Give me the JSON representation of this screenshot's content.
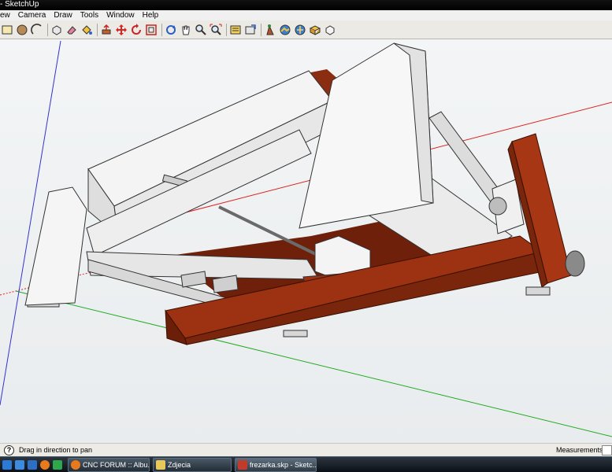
{
  "window": {
    "title": "- SketchUp"
  },
  "menus": [
    "ew",
    "Camera",
    "Draw",
    "Tools",
    "Window",
    "Help"
  ],
  "toolbar": {
    "tools": [
      "rectangle-icon",
      "circle-icon",
      "arc-icon",
      "separator",
      "make-component-icon",
      "eraser-icon",
      "paint-bucket-icon",
      "separator",
      "push-pull-icon",
      "move-icon",
      "rotate-icon",
      "offset-icon",
      "separator",
      "orbit-icon",
      "pan-icon",
      "zoom-icon",
      "zoom-extents-icon",
      "separator",
      "get-models-icon",
      "share-model-icon",
      "separator",
      "google-earth-icon",
      "toggle-terrain-icon",
      "place-model-icon",
      "get-current-view-icon",
      "get-photo-texture-icon"
    ]
  },
  "status": {
    "message": "Drag in direction to pan",
    "measurements_label": "Measurements",
    "measurements_value": ""
  },
  "taskbar": {
    "items": [
      {
        "label": "CNC FORUM :: Albu...",
        "icon": "firefox-icon",
        "active": false
      },
      {
        "label": "Zdjecia",
        "icon": "folder-icon",
        "active": false
      },
      {
        "label": "frezarka.skp - Sketc...",
        "icon": "sketchup-icon",
        "active": true
      }
    ]
  },
  "colors": {
    "frame_wood": "#9c3212",
    "frame_wood_dark": "#6f200a",
    "panel_white": "#f1f1f1",
    "axis_red": "#d22",
    "axis_green": "#2a2",
    "axis_blue": "#33c"
  }
}
